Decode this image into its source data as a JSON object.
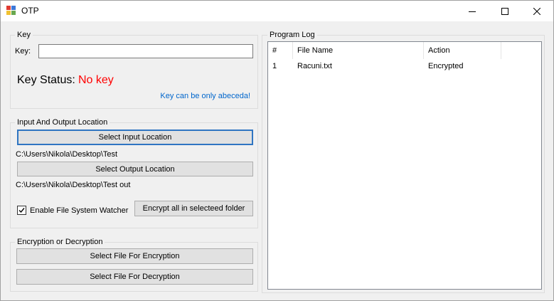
{
  "window": {
    "title": "OTP",
    "minimize_glyph": "minimize-icon",
    "maximize_glyph": "maximize-icon",
    "close_glyph": "close-icon"
  },
  "key_group": {
    "title": "Key",
    "key_label": "Key:",
    "key_value": "",
    "status_label": "Key Status:",
    "status_value": "No key",
    "hint": "Key can be only abeceda!"
  },
  "io_group": {
    "title": "Input And Output Location",
    "select_input_label": "Select Input Location",
    "input_path": "C:\\Users\\Nikola\\Desktop\\Test",
    "select_output_label": "Select Output Location",
    "output_path": "C:\\Users\\Nikola\\Desktop\\Test out",
    "watcher_label": "Enable File System Watcher",
    "watcher_checked": true,
    "encrypt_all_label": "Encrypt all in selecteed folder"
  },
  "crypt_group": {
    "title": "Encryption or Decryption",
    "encrypt_file_label": "Select File For Encryption",
    "decrypt_file_label": "Select File For Decryption"
  },
  "log_group": {
    "title": "Program Log",
    "columns": [
      "#",
      "File Name",
      "Action"
    ],
    "rows": [
      {
        "num": "1",
        "file": "Racuni.txt",
        "action": "Encrypted"
      }
    ]
  },
  "colors": {
    "status_error": "#ff0000",
    "hint_link": "#0066cc",
    "focus_border": "#2f75c2"
  }
}
